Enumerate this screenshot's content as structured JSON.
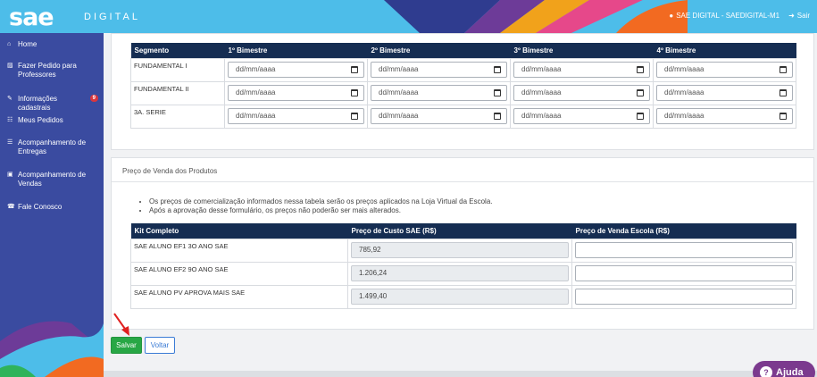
{
  "header": {
    "logo": "sae",
    "logo_sub": "DIGITAL",
    "user": "SAE DIGITAL - SAEDIGITAL-M1",
    "logout": "Sair"
  },
  "sidebar": {
    "items": [
      {
        "label": "Home",
        "icon": "home-icon"
      },
      {
        "label": "Fazer Pedido para Professores",
        "icon": "cart-icon"
      },
      {
        "label": "Informações cadastrais",
        "icon": "edit-icon",
        "badge": "9"
      },
      {
        "label": "Meus Pedidos",
        "icon": "orders-icon"
      },
      {
        "label": "Acompanhamento de Entregas",
        "icon": "list-icon"
      },
      {
        "label": "Acompanhamento de Vendas",
        "icon": "money-icon"
      },
      {
        "label": "Fale Conosco",
        "icon": "phone-icon"
      }
    ]
  },
  "schedule": {
    "headers": [
      "Segmento",
      "1º Bimestre",
      "2º Bimestre",
      "3º Bimestre",
      "4º Bimestre"
    ],
    "date_placeholder": "dd/mm/aaaa",
    "rows": [
      "FUNDAMENTAL I",
      "FUNDAMENTAL II",
      "3A. SERIE"
    ]
  },
  "prices": {
    "title": "Preço de Venda dos Produtos",
    "notes": [
      "Os preços de comercialização informados nessa tabela serão os preços aplicados na Loja Virtual da Escola.",
      "Após a aprovação desse formulário, os preços não poderão ser mais alterados."
    ],
    "headers": [
      "Kit Completo",
      "Preço de Custo SAE (R$)",
      "Preço de Venda Escola (R$)"
    ],
    "rows": [
      {
        "kit": "SAE ALUNO EF1 3O ANO SAE",
        "cost": "785,92",
        "sale": ""
      },
      {
        "kit": "SAE ALUNO EF2 9O ANO SAE",
        "cost": "1.206,24",
        "sale": ""
      },
      {
        "kit": "SAE ALUNO PV APROVA MAIS SAE",
        "cost": "1.499,40",
        "sale": ""
      }
    ]
  },
  "actions": {
    "save": "Salvar",
    "back": "Voltar"
  },
  "help": {
    "label": "Ajuda"
  },
  "colors": {
    "header": "#4dbde9",
    "sidebar": "#3a4ba0",
    "table_header": "#152d52",
    "save": "#28a745",
    "help": "#7b3a8e"
  }
}
